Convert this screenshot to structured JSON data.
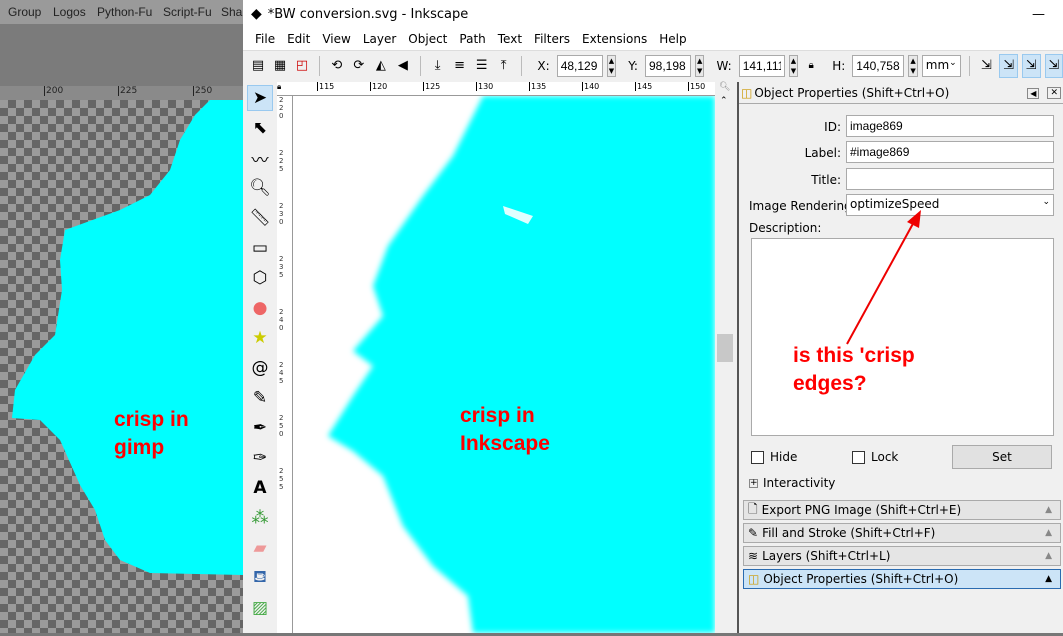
{
  "gimp": {
    "menu": [
      "Group",
      "Logos",
      "Python-Fu",
      "Script-Fu",
      "Sha"
    ],
    "ruler": [
      "200",
      "225",
      "250"
    ],
    "annotation": "crisp in\ngimp"
  },
  "inkscape": {
    "title": "*BW conversion.svg - Inkscape",
    "minimize": "—",
    "menu": [
      "File",
      "Edit",
      "View",
      "Layer",
      "Object",
      "Path",
      "Text",
      "Filters",
      "Extensions",
      "Help"
    ],
    "toolbar": {
      "x_label": "X:",
      "x": "48,129",
      "y_label": "Y:",
      "y": "98,198",
      "w_label": "W:",
      "w": "141,111",
      "h_label": "H:",
      "h": "140,758",
      "unit": "mm"
    },
    "hruler": [
      "115",
      "120",
      "125",
      "130",
      "135",
      "140",
      "145",
      "150"
    ],
    "vruler": [
      "2\n2\n0",
      "2\n2\n5",
      "2\n3\n0",
      "2\n3\n5",
      "2\n4\n0",
      "2\n4\n5",
      "2\n5\n0",
      "2\n5\n5"
    ],
    "annotation": "crisp in\nInkscape"
  },
  "panel": {
    "title": "Object Properties (Shift+Ctrl+O)",
    "id_label": "ID:",
    "id": "image869",
    "label_label": "Label:",
    "label": "#image869",
    "title_label": "Title:",
    "title_value": "",
    "rendering_label": "Image Rendering:",
    "rendering": "optimizeSpeed",
    "description_label": "Description:",
    "hide": "Hide",
    "lock": "Lock",
    "set": "Set",
    "interactivity": "Interactivity",
    "docks": [
      "Export PNG Image (Shift+Ctrl+E)",
      "Fill and Stroke (Shift+Ctrl+F)",
      "Layers (Shift+Ctrl+L)",
      "Object Properties (Shift+Ctrl+O)"
    ],
    "annotation": "is this 'crisp\nedges?"
  },
  "colors": {
    "cyan": "#00ffff",
    "annotation": "#ff0000",
    "active": "#cce4f7"
  }
}
